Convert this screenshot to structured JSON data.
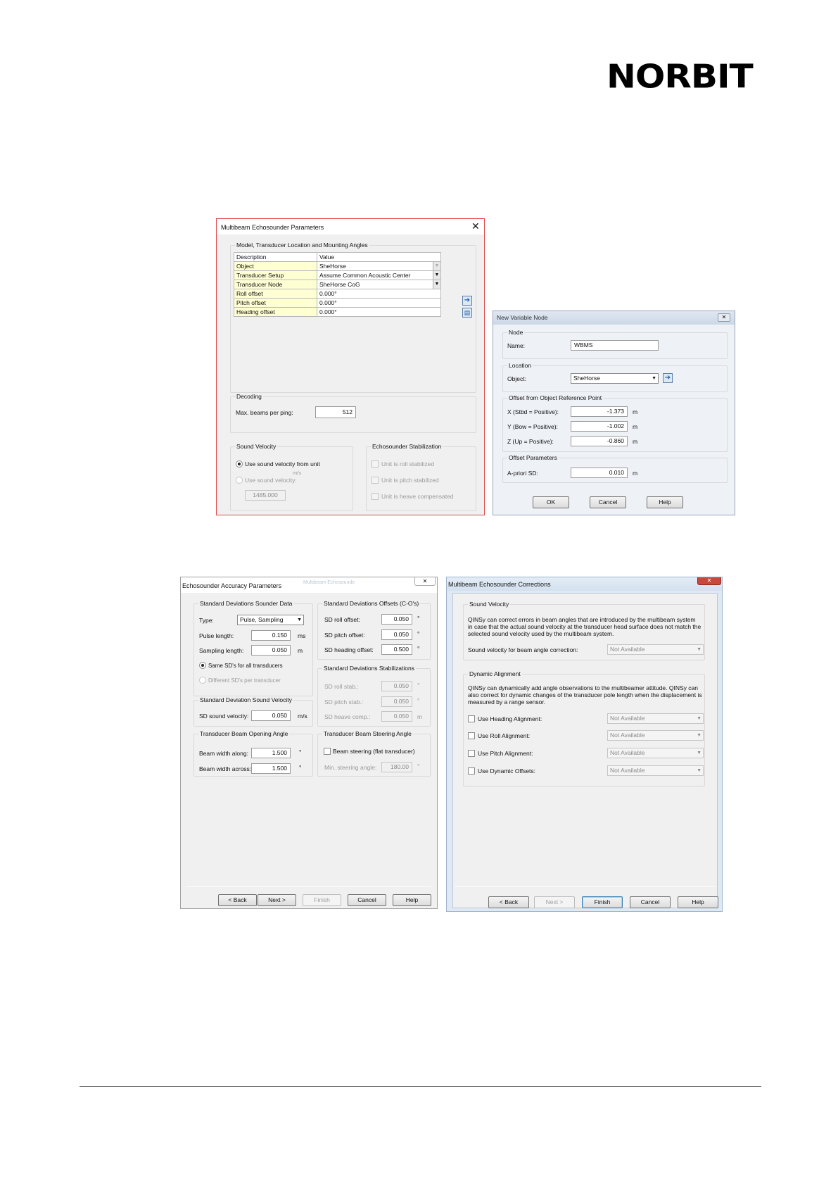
{
  "logo": {
    "text": "NORBIT"
  },
  "multibeam_params": {
    "title": "Multibeam Echosounder Parameters",
    "group_model": "Model, Transducer Location and Mounting Angles",
    "grid": [
      {
        "key": "Description",
        "value": "Value"
      },
      {
        "key": "Object",
        "value": "SheHorse"
      },
      {
        "key": "Transducer Setup",
        "value": "Assume Common Acoustic Center"
      },
      {
        "key": "Transducer Node",
        "value": "SheHorse CoG"
      },
      {
        "key": "Roll offset",
        "value": "0.000°"
      },
      {
        "key": "Pitch offset",
        "value": "0.000°"
      },
      {
        "key": "Heading offset",
        "value": "0.000°"
      }
    ],
    "group_decoding": "Decoding",
    "max_beams_label": "Max. beams per ping:",
    "max_beams_value": "512",
    "group_sound_velocity": "Sound Velocity",
    "use_sv_unit": "Use sound velocity from unit",
    "sv_unit": "m/s",
    "use_sv": "Use sound velocity:",
    "sv_value": "1485.000",
    "group_stabilization": "Echosounder Stabilization",
    "stab_roll": "Unit is roll stabilized",
    "stab_pitch": "Unit is pitch stabilized",
    "stab_heave": "Unit is heave compensated"
  },
  "new_variable_node": {
    "title": "New Variable Node",
    "group_node": "Node",
    "name_label": "Name:",
    "name_value": "WBMS",
    "group_location": "Location",
    "object_label": "Object:",
    "object_value": "SheHorse",
    "group_offset": "Offset from Object Reference Point",
    "x_label": "X (Stbd = Positive):",
    "x_value": "-1.373",
    "y_label": "Y (Bow = Positive):",
    "y_value": "-1.002",
    "z_label": "Z (Up = Positive):",
    "z_value": "-0.860",
    "unit_m": "m",
    "group_offset_params": "Offset Parameters",
    "apriori_label": "A-priori SD:",
    "apriori_value": "0.010",
    "ok": "OK",
    "cancel": "Cancel",
    "help": "Help"
  },
  "accuracy": {
    "title": "Echosounder Accuracy Parameters",
    "ghost_tab": "Multibeam Echosounde",
    "group_sd_sounder": "Standard Deviations Sounder Data",
    "type_label": "Type:",
    "type_value": "Pulse, Sampling",
    "pulse_label": "Pulse length:",
    "pulse_value": "0.150",
    "pulse_unit": "ms",
    "sampling_label": "Sampling length:",
    "sampling_value": "0.050",
    "sampling_unit": "m",
    "same_sd": "Same SD's for all transducers",
    "diff_sd": "Different SD's per transducer",
    "group_sd_sv": "Standard Deviation Sound Velocity",
    "sd_sv_label": "SD sound velocity:",
    "sd_sv_value": "0.050",
    "sd_sv_unit": "m/s",
    "group_beam_opening": "Transducer Beam Opening Angle",
    "bw_along_label": "Beam width along:",
    "bw_along_value": "1.500",
    "bw_across_label": "Beam width across:",
    "bw_across_value": "1.500",
    "deg": "°",
    "group_sd_offsets": "Standard Deviations Offsets (C-O's)",
    "sd_roll_label": "SD roll offset:",
    "sd_roll_value": "0.050",
    "sd_pitch_label": "SD pitch offset:",
    "sd_pitch_value": "0.050",
    "sd_heading_label": "SD heading offset:",
    "sd_heading_value": "0.500",
    "group_sd_stab": "Standard Deviations Stabilizations",
    "sd_roll_stab_label": "SD roll stab.:",
    "sd_roll_stab_value": "0.050",
    "sd_pitch_stab_label": "SD pitch stab.:",
    "sd_pitch_stab_value": "0.050",
    "sd_heave_label": "SD heave comp.:",
    "sd_heave_value": "0.050",
    "unit_m": "m",
    "group_beam_steering": "Transducer Beam Steering Angle",
    "beam_steering_label": "Beam steering (flat transducer)",
    "min_steering_label": "Min. steering angle:",
    "min_steering_value": "180.00",
    "back": "< Back",
    "next": "Next >",
    "finish": "Finish",
    "cancel": "Cancel",
    "help": "Help"
  },
  "corrections": {
    "title": "Multibeam Echosounder Corrections",
    "group_sv": "Sound Velocity",
    "sv_text": "QINSy can correct errors in beam angles that are introduced by the multibeam system in case that the actual sound velocity at the transducer head surface does not match the selected sound velocity used by the multibeam system.",
    "sv_beam_label": "Sound velocity for beam angle correction:",
    "not_available": "Not Available",
    "group_dyn": "Dynamic Alignment",
    "dyn_text": "QINSy can dynamically add angle observations to the multibeamer attitude. QINSy can also correct for dynamic changes of the transducer pole length when the displacement is measured by a range sensor.",
    "use_heading": "Use Heading Alignment:",
    "use_roll": "Use Roll Alignment:",
    "use_pitch": "Use Pitch Alignment:",
    "use_dynamic": "Use Dynamic Offsets:",
    "back": "< Back",
    "next": "Next >",
    "finish": "Finish",
    "cancel": "Cancel",
    "help": "Help"
  }
}
